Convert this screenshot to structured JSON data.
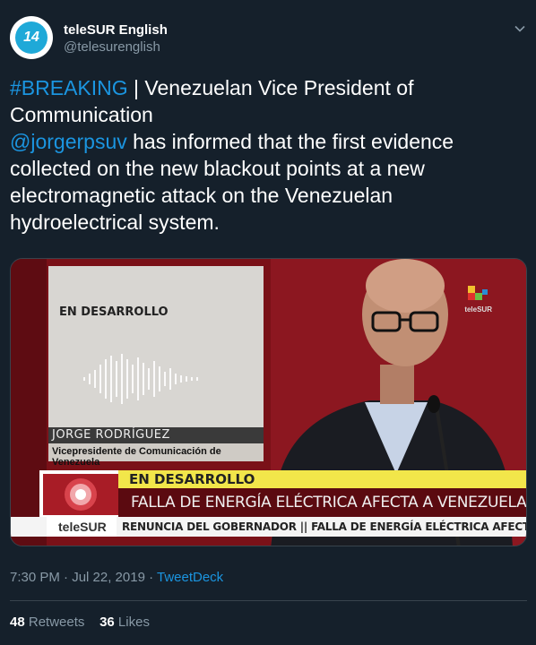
{
  "account": {
    "display_name": "teleSUR English",
    "handle": "@telesurenglish",
    "avatar_text": "14"
  },
  "tweet": {
    "hashtag": "#BREAKING",
    "line1_rest": " | Venezuelan Vice President of Communication",
    "mention": "@jorgerpsuv",
    "body_rest": " has informed that the first evidence collected on the new blackout points at a new electromagnetic attack on the Venezuelan hydroelectrical system."
  },
  "media": {
    "card_title": "EN DESARROLLO",
    "person_name": "JORGE RODRÍGUEZ",
    "person_role": "Vicepresidente de Comunicación de Venezuela",
    "brand": "teleSUR",
    "banner_top": "EN DESARROLLO",
    "banner_main": "FALLA DE ENERGÍA ELÉCTRICA AFECTA A VENEZUELA",
    "ticker_logo": "teleSUR",
    "ticker": "RENUNCIA DEL GOBERNADOR  ||  FALLA DE ENERGÍA ELÉCTRICA AFECTA A VENEZU"
  },
  "meta": {
    "time": "7:30 PM · Jul 22, 2019 · ",
    "source": "TweetDeck"
  },
  "stats": {
    "retweets_count": "48",
    "retweets_label": "Retweets",
    "likes_count": "36",
    "likes_label": "Likes"
  },
  "icons": {
    "menu": "chevron-down-icon"
  },
  "colors": {
    "background": "#15202b",
    "link": "#1b95e0",
    "muted": "#8899a6"
  }
}
